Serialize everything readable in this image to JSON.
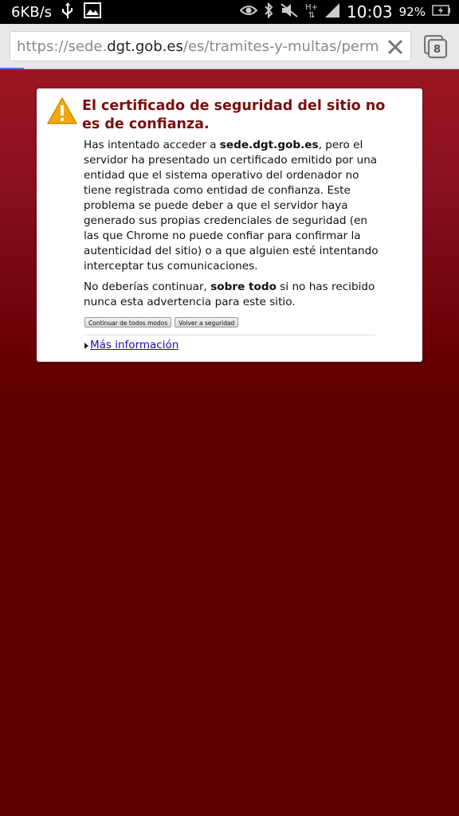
{
  "status_bar": {
    "net_speed": "6KB/s",
    "network_type": "H+",
    "time": "10:03",
    "battery": "92%",
    "icons": [
      "usb-icon",
      "image-icon",
      "eye-icon",
      "bluetooth-icon",
      "mute-icon",
      "signal-icon",
      "battery-charging-icon"
    ]
  },
  "toolbar": {
    "url_scheme": "https://sede.",
    "url_host": "dgt.gob.es",
    "url_path": "/es/tramites-y-multas/permiso-po",
    "tab_count": "8"
  },
  "warning": {
    "title": "El certificado de seguridad del sitio no es de confianza.",
    "p1_before": "Has intentado acceder a ",
    "p1_site": "sede.dgt.gob.es",
    "p1_after": ", pero el servidor ha presentado un certificado emitido por una entidad que el sistema operativo del ordenador no tiene registrada como entidad de confianza. Este problema se puede deber a que el servidor haya generado sus propias credenciales de seguridad (en las que Chrome no puede confiar para confirmar la autenticidad del sitio) o a que alguien esté intentando interceptar tus comunicaciones.",
    "p2_before": "No deberías continuar, ",
    "p2_bold": "sobre todo",
    "p2_after": " si no has recibido nunca esta advertencia para este sitio.",
    "proceed_label": "Continuar de todos modos",
    "back_label": "Volver a seguridad",
    "more_info_label": "Más información"
  },
  "colors": {
    "page_top": "#9b1622",
    "page_bottom": "#5e0000",
    "title": "#7a0e0e",
    "warning_icon": "#f0a80f",
    "link": "#1a0dab"
  }
}
